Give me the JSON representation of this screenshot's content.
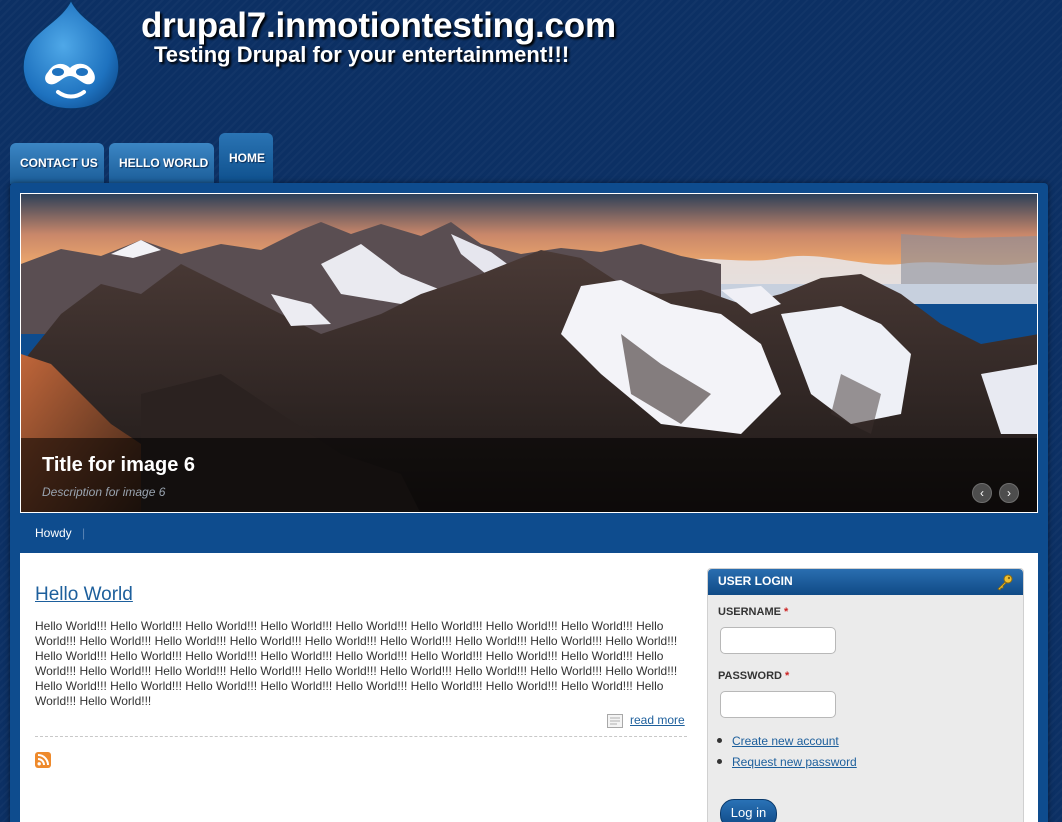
{
  "site": {
    "name": "drupal7.inmotiontesting.com",
    "slogan": "Testing Drupal for your entertainment!!!"
  },
  "nav": {
    "tabs": [
      {
        "label": "CONTACT US",
        "active": false
      },
      {
        "label": "HELLO WORLD",
        "active": false
      },
      {
        "label": "HOME",
        "active": true
      }
    ]
  },
  "slideshow": {
    "title": "Title for image 6",
    "description": "Description for image 6",
    "prev_label": "‹",
    "next_label": "›"
  },
  "subnav": {
    "items": [
      {
        "label": "Howdy"
      }
    ],
    "separator": "|"
  },
  "node": {
    "title": "Hello World",
    "body": "Hello World!!! Hello World!!! Hello World!!! Hello World!!! Hello World!!! Hello World!!! Hello World!!! Hello World!!! Hello World!!! Hello World!!! Hello World!!! Hello World!!! Hello World!!! Hello World!!! Hello World!!! Hello World!!! Hello World!!! Hello World!!! Hello World!!! Hello World!!! Hello World!!! Hello World!!! Hello World!!! Hello World!!! Hello World!!! Hello World!!! Hello World!!! Hello World!!! Hello World!!! Hello World!!! Hello World!!! Hello World!!! Hello World!!! Hello World!!! Hello World!!! Hello World!!! Hello World!!! Hello World!!! Hello World!!! Hello World!!! Hello World!!! Hello World!!! Hello World!!! Hello World!!!",
    "read_more": "read more"
  },
  "login": {
    "title": "USER LOGIN",
    "username_label": "USERNAME",
    "password_label": "PASSWORD",
    "required_marker": "*",
    "username_value": "",
    "password_value": "",
    "links": [
      {
        "label": "Create new account"
      },
      {
        "label": "Request new password"
      }
    ],
    "submit_label": "Log in"
  },
  "colors": {
    "page_background": "#0c3064",
    "frame": "#0e4c8e",
    "tab": "#1b5d98",
    "link": "#1d5f9c",
    "required": "#cc2222"
  },
  "icons": [
    "drupal-logo",
    "slideshow-prev-icon",
    "slideshow-next-icon",
    "read-more-icon",
    "rss-feed-icon",
    "key-icon"
  ]
}
